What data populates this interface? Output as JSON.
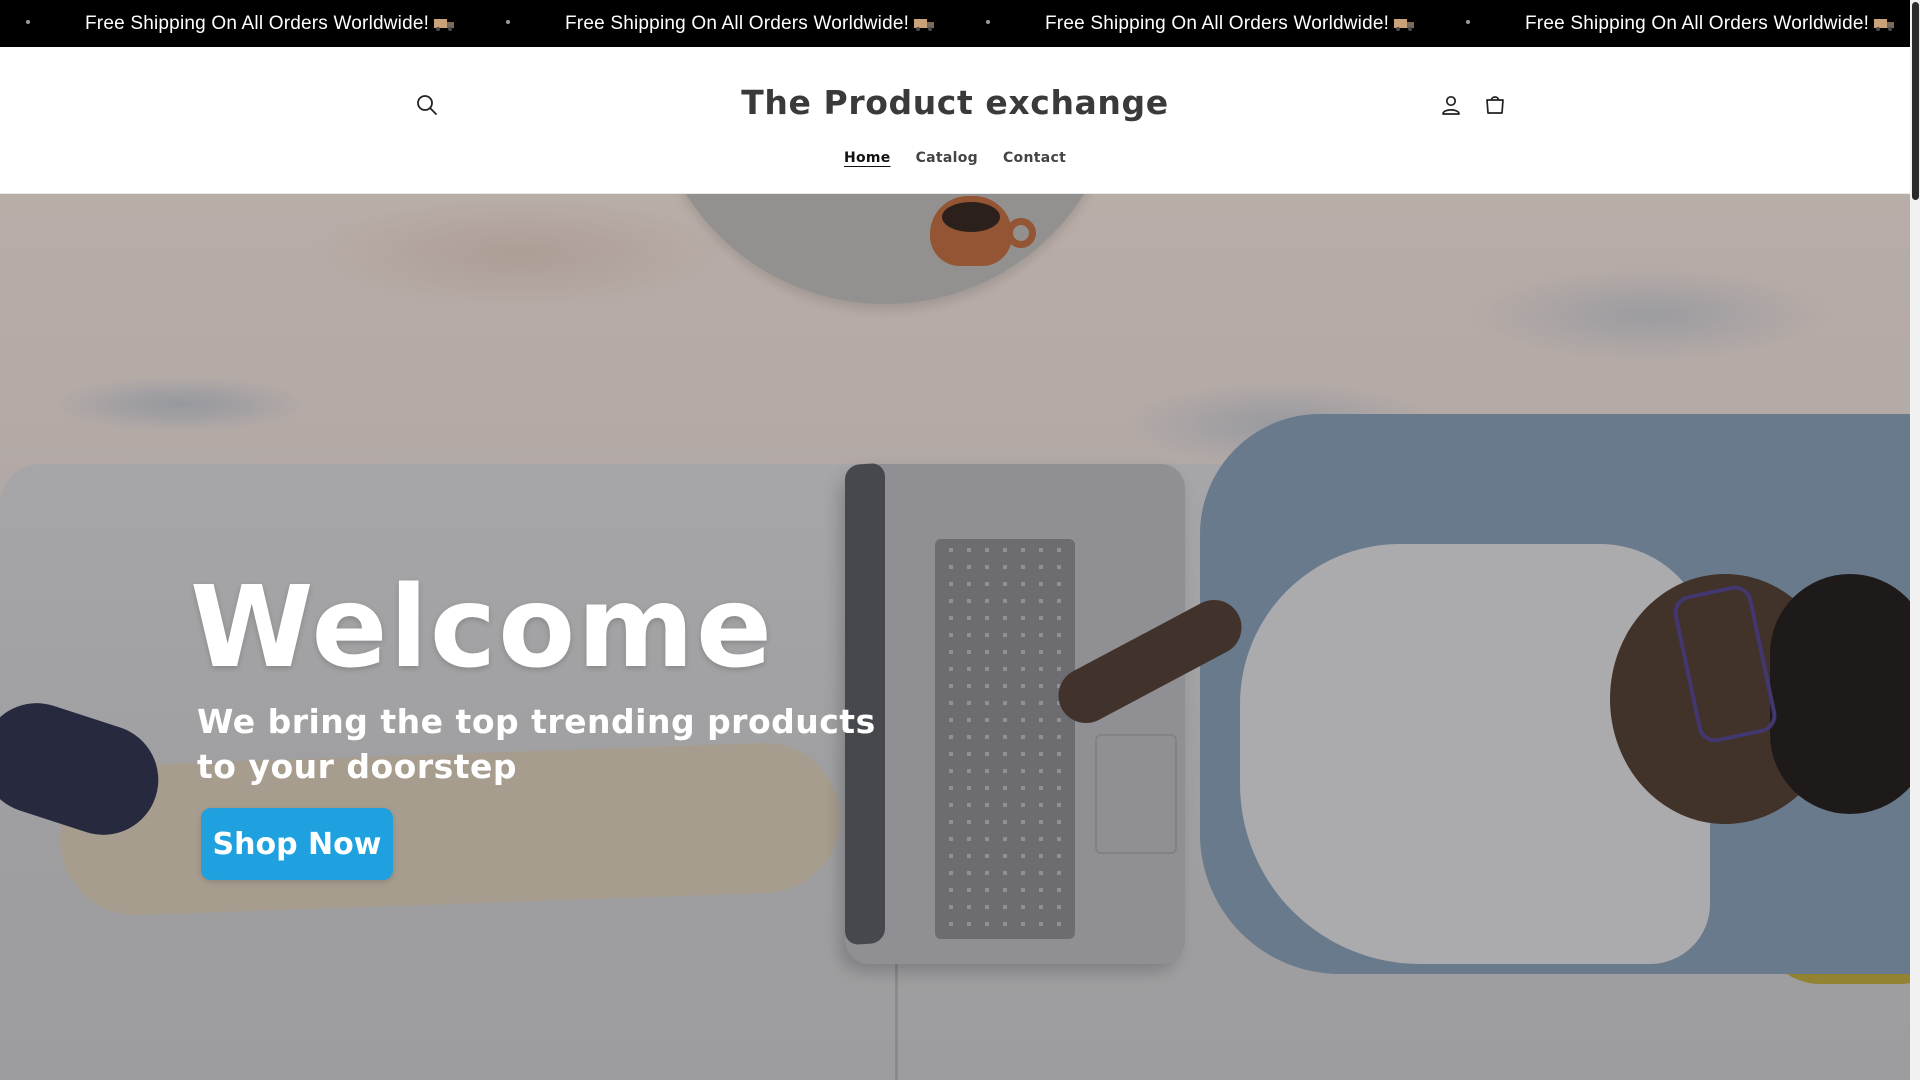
{
  "announcement": {
    "items": [
      "Free Shipping On All Orders Worldwide!",
      "Free Shipping On All Orders Worldwide!",
      "Free Shipping On All Orders Worldwide!",
      "Free Shipping On All Orders Worldwide!"
    ],
    "icon": "truck-icon",
    "background": "#000000",
    "text_color": "#ffffff"
  },
  "header": {
    "logo": "The Product exchange",
    "search_icon": "search-icon",
    "account_icon": "account-icon",
    "cart_icon": "cart-icon"
  },
  "nav": {
    "items": [
      {
        "label": "Home",
        "active": true
      },
      {
        "label": "Catalog",
        "active": false
      },
      {
        "label": "Contact",
        "active": false
      }
    ]
  },
  "hero": {
    "title": "Welcome",
    "subtitle": "We bring the top trending products to your doorstep",
    "button_label": "Shop Now",
    "button_color": "#1fa0df"
  }
}
